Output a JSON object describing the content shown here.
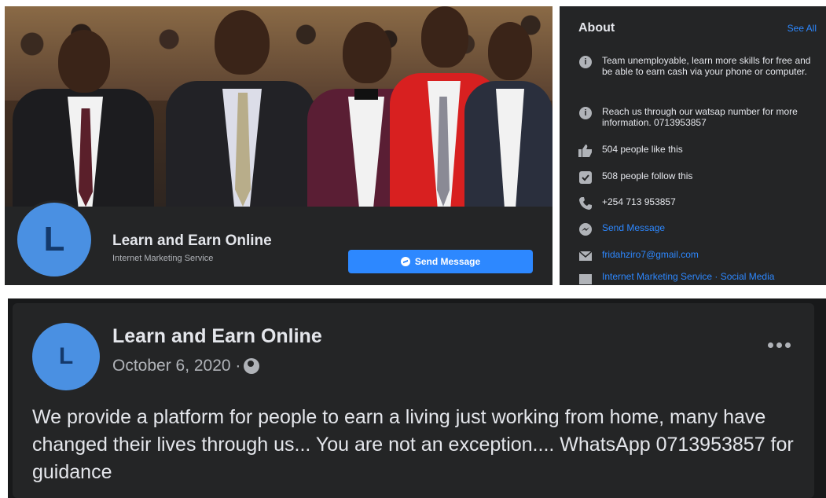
{
  "page": {
    "name": "Learn and Earn Online",
    "category": "Internet Marketing Service",
    "avatar_letter": "L",
    "send_message_label": "Send Message"
  },
  "about": {
    "title": "About",
    "see_all": "See All",
    "description": "Team unemployable, learn more skills for free and be able to earn cash via your phone or computer.",
    "contact_note": "Reach us through our watsap number for more information. 0713953857",
    "likes": "504 people like this",
    "follows": "508 people follow this",
    "phone": "+254 713 953857",
    "send_message": "Send Message",
    "email": "fridahziro7@gmail.com",
    "categories": "Internet Marketing Service · Social Media"
  },
  "post": {
    "author": "Learn and Earn Online",
    "avatar_letter": "L",
    "date": "October 6, 2020 ·",
    "text": "We provide a platform for people to earn a living just working from home, many have changed their lives through us... You are not an exception.... WhatsApp 0713953857 for guidance"
  },
  "colors": {
    "panel_bg": "#242526",
    "accent": "#2d88ff",
    "avatar_bg": "#4a90e2",
    "text_primary": "#e4e6eb",
    "text_secondary": "#b0b3b8"
  },
  "icons": [
    "info-icon",
    "thumbs-up-icon",
    "follow-icon",
    "phone-icon",
    "messenger-icon",
    "mail-icon",
    "category-icon",
    "globe-icon",
    "more-icon"
  ]
}
